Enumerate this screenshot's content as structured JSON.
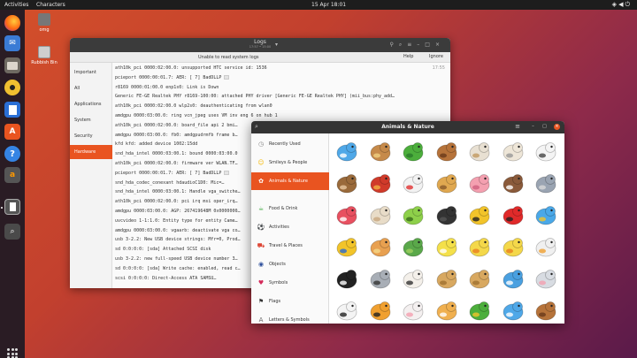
{
  "topbar": {
    "activities": "Activities",
    "app_menu": "Characters",
    "clock": "15 Apr  18:01"
  },
  "desktop": {
    "icons": [
      {
        "label": "omg"
      },
      {
        "label": "Rubbish Bin"
      }
    ]
  },
  "logs": {
    "title": "Logs",
    "subtitle": "17:57 • 15:00",
    "banner_message": "Unable to read system logs",
    "help_label": "Help",
    "ignore_label": "Ignore",
    "sidebar": [
      "Important",
      "All",
      "Applications",
      "System",
      "Security",
      "Hardware"
    ],
    "active_index": 5,
    "time": "17:55",
    "rows": [
      "ath10k_pci 0000:02:00.0: unsupported HTC service id: 1536",
      "pcieport 0000:00:01.7: AER:   [ 7] BadDLLP",
      "r8169 0000:01:00.0 enp1s0: Link is Down",
      "Generic FE-GE Realtek PHY r8169-100:00: attached PHY driver [Generic FE-GE Realtek PHY] (mii_bus:phy_add…",
      "ath10k_pci 0000:02:00.0 wlp2s0: deauthenticating from wlan0",
      "amdgpu 0000:03:00.0: ring vcn_jpeg uses VM inv eng 6 on hub 1",
      "ath10k_pci 0000:02:00.0: board_file api 2 bmi…",
      "amdgpu 0000:03:00.0: fb0: amdgpudrmfb frame b…",
      "kfd kfd: added device 1002:15dd",
      "snd_hda_intel 0000:03:00.1: bound 0000:03:00.0",
      "ath10k_pci 0000:02:00.0: firmware ver WLAN.TF…",
      "pcieport 0000:00:01.7: AER:   [ 7] BadDLLP",
      "snd_hda_codec_conexant hdaudioC1D0:      Mic=…",
      "snd_hda_intel 0000:03:00.1: Handle vga_switche…",
      "ath10k_pci 0000:02:00.0: pci irq msi oper_irq…",
      "amdgpu 0000:03:00.0: AGP: 267419648M 0x0000000…",
      "uvcvideo 1-1:1.0: Entity type for entity Came…",
      "amdgpu 0000:03:00.0: vgaarb: deactivate vga co…",
      "usb 3-2.2: New USB device strings: Mfr=0, Prod…",
      "sd 0:0:0:0: [sda] Attached SCSI disk",
      "usb 3-2.2: new full-speed USB device number 3…",
      "sd 0:0:0:0: [sda] Write cache: enabled, read c…",
      "scsi 0:0:0:0: Direct-Access     ATA      SAMSU…"
    ]
  },
  "characters": {
    "title": "Animals & Nature",
    "active_index": 2,
    "categories": [
      {
        "label": "Recently Used",
        "icon": "clock-icon"
      },
      {
        "label": "Smileys & People",
        "icon": "smiley-icon"
      },
      {
        "label": "Animals & Nature",
        "icon": "paw-icon"
      },
      {
        "label": "Food & Drink",
        "icon": "food-icon"
      },
      {
        "label": "Activities",
        "icon": "ball-icon"
      },
      {
        "label": "Travel & Places",
        "icon": "car-icon"
      },
      {
        "label": "Objects",
        "icon": "object-icon"
      },
      {
        "label": "Symbols",
        "icon": "symbol-icon"
      },
      {
        "label": "Flags",
        "icon": "flag-icon"
      },
      {
        "label": "Letters & Symbols",
        "icon": "letters-icon"
      }
    ],
    "emoji_grid": [
      [
        "whale",
        "snail",
        "snake",
        "horse",
        "ram",
        "goat",
        "sheep"
      ],
      [
        "monkey",
        "rooster",
        "chicken",
        "dog",
        "pig",
        "boar",
        "elephant"
      ],
      [
        "octopus",
        "spiral-shell",
        "bug",
        "ant",
        "honeybee",
        "lady-beetle",
        "fish"
      ],
      [
        "tropical-fish",
        "blowfish",
        "turtle",
        "hatching-chick",
        "baby-chick",
        "chick",
        "cat"
      ],
      [
        "penguin",
        "koala",
        "poodle",
        "camel",
        "two-hump-camel",
        "dolphin",
        "mouse"
      ],
      [
        "cow",
        "tiger",
        "rabbit",
        "cat-face",
        "dragon",
        "whale-spout",
        "horse-face"
      ]
    ]
  },
  "colors": {
    "accent": "#e95420",
    "header_dark": "#333333",
    "topbar": "#1d1d1d"
  }
}
